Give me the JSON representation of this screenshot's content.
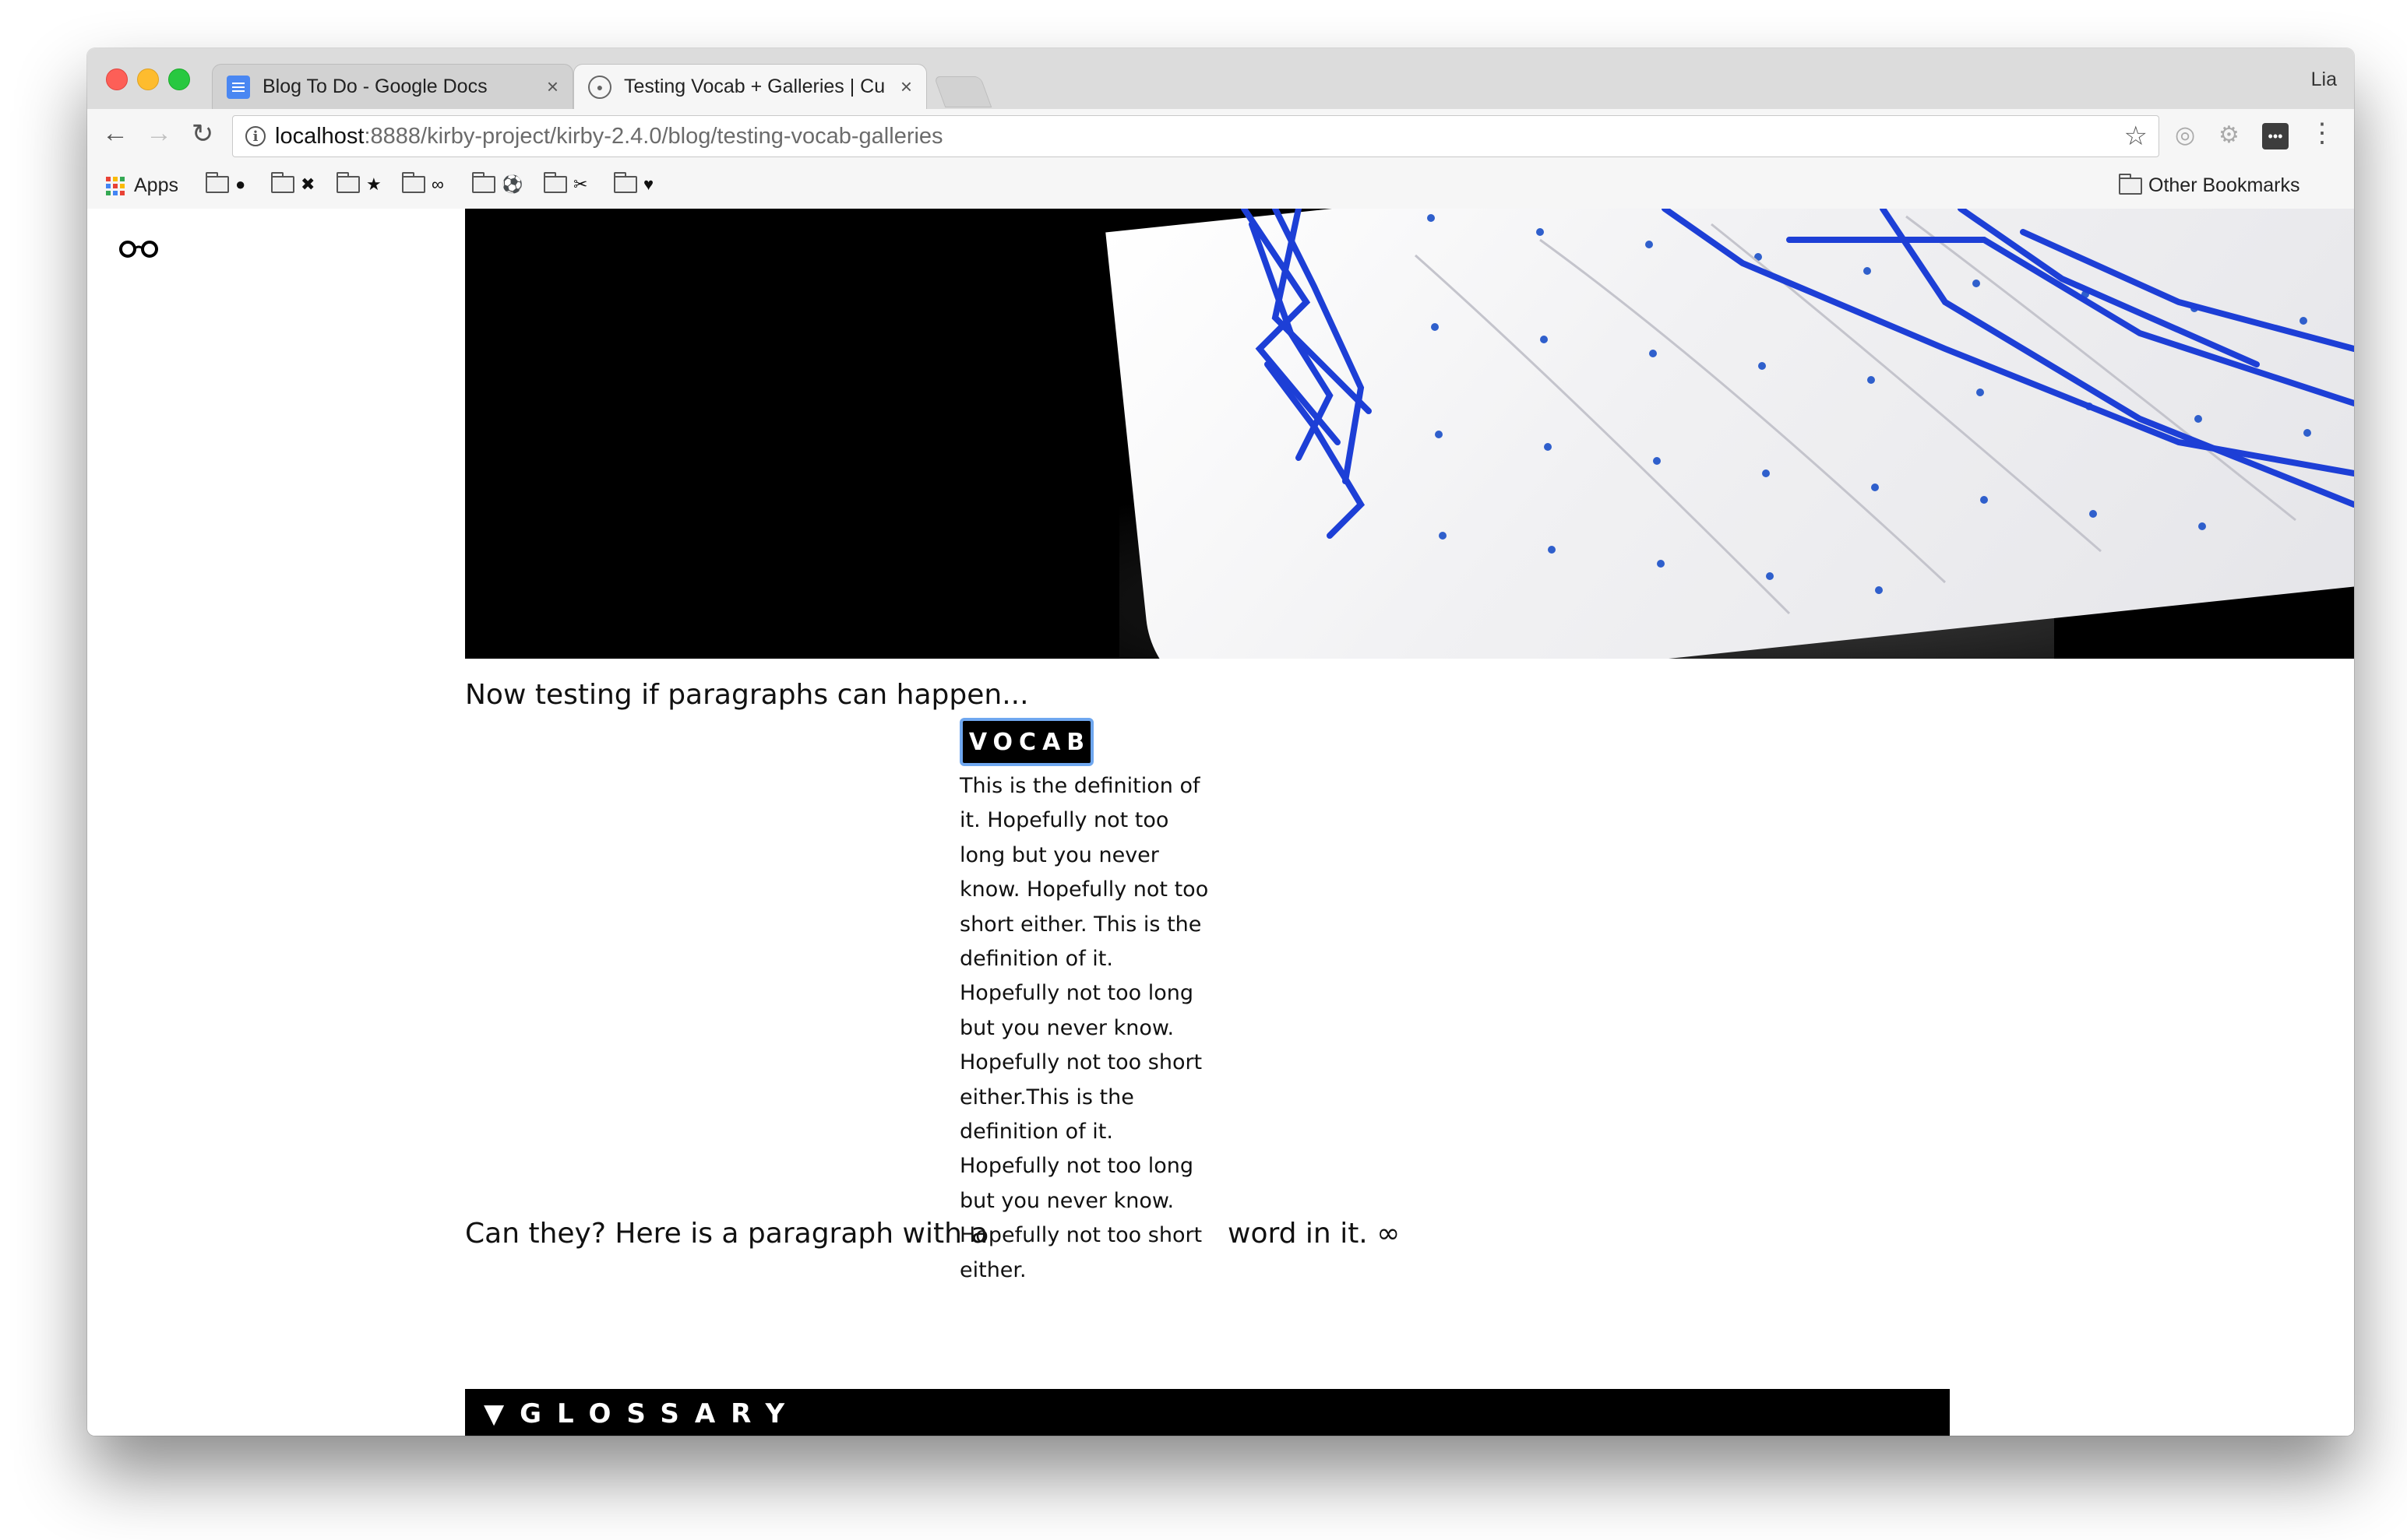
{
  "browser": {
    "tabs": [
      {
        "title": "Blog To Do - Google Docs",
        "close": "×",
        "favicon": "google-docs-icon"
      },
      {
        "title": "Testing Vocab + Galleries | Cu",
        "close": "×",
        "favicon": "github-icon"
      }
    ],
    "profile": "Lia",
    "url_host": "localhost",
    "url_rest": ":8888/kirby-project/kirby-2.4.0/blog/testing-vocab-galleries",
    "bookmarks": [
      {
        "label": "Apps",
        "icon": "apps-grid-icon"
      },
      {
        "label": "",
        "glyph": "●"
      },
      {
        "label": "",
        "glyph": "✖"
      },
      {
        "label": "",
        "glyph": "★"
      },
      {
        "label": "",
        "glyph": "∞"
      },
      {
        "label": "",
        "glyph": "⚽"
      },
      {
        "label": "",
        "glyph": "✂"
      },
      {
        "label": "",
        "glyph": "♥"
      }
    ],
    "other_bookmarks": "Other Bookmarks"
  },
  "page": {
    "logo_glyph": "👓",
    "paragraph1": "Now testing if paragraphs can happen...",
    "vocab_term": "VOCAB",
    "vocab_definition": "This is the definition of it. Hopefully not too long but you never know. Hopefully not too short either. This is the definition of it. Hopefully not too long but you never know. Hopefully not too short either.This is the definition of it. Hopefully not too long but you never know. Hopefully not too short either.",
    "paragraph2_before": "Can they? Here is a paragraph with a",
    "paragraph2_after": "word in it.",
    "paragraph2_glyph": "∞",
    "glossary_label": "▼GLOSSARY"
  },
  "colors": {
    "accent_focus": "#6fa7ef",
    "black": "#000000"
  }
}
